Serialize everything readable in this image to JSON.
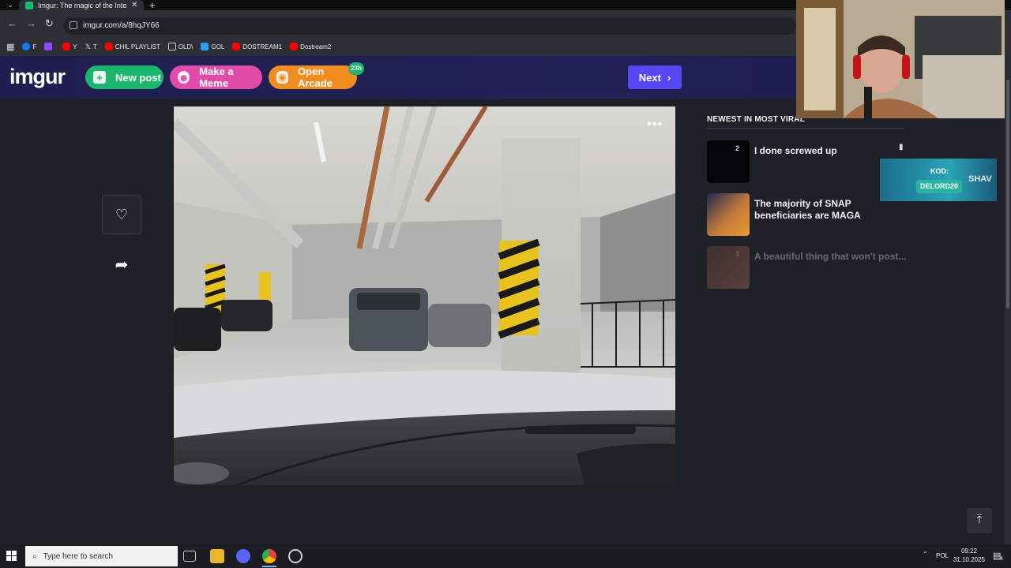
{
  "browser": {
    "tab_title": "Imgur: The magic of the Interne",
    "url": "imgur.com/a/8hqJY66",
    "bookmarks": [
      {
        "label": "F",
        "color": "#1877f2"
      },
      {
        "label": "",
        "color": "#9146ff"
      },
      {
        "label": "Y",
        "color": "#ff0000"
      },
      {
        "label": "T",
        "color": "#000000"
      },
      {
        "label": "CHIL PLAYLIST",
        "color": "#ff0000"
      },
      {
        "label": "OLD\\",
        "color": "folder"
      },
      {
        "label": "GOL",
        "color": "#2a9df4"
      },
      {
        "label": "DOSTREAM1",
        "color": "#ff0000"
      },
      {
        "label": "Dostream2",
        "color": "#ff0000"
      }
    ]
  },
  "header": {
    "logo": "imgur",
    "new_post": "New post",
    "make_meme": "Make a Meme",
    "open_arcade": "Open Arcade",
    "arcade_badge": "23h",
    "next": "Next",
    "brand_color": "#1bb76e"
  },
  "viral": {
    "heading": "NEWEST IN MOST VIRAL",
    "items": [
      {
        "num": "2",
        "title": "I done screwed up"
      },
      {
        "num": "",
        "title": "The majority of SNAP beneficiaries are MAGA"
      },
      {
        "num": "3",
        "title": "A beautiful thing that won't post..."
      }
    ]
  },
  "promo": {
    "label": "KOD:",
    "code": "DELORD20",
    "brand": "SHAV"
  },
  "taskbar": {
    "search_placeholder": "Type here to search",
    "lang": "POL",
    "time": "09:22",
    "date": "31.10.2025",
    "notifications": "4"
  }
}
